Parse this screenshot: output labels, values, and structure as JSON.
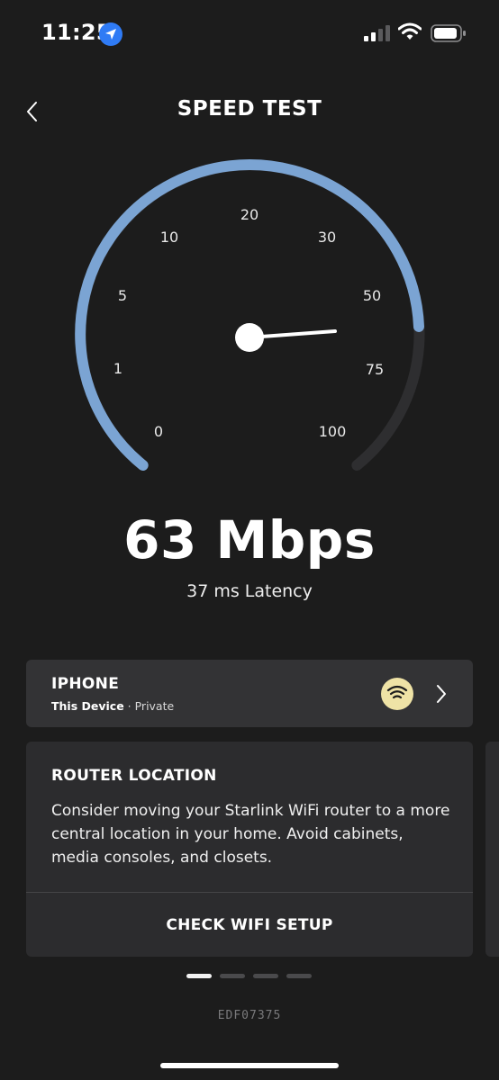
{
  "status_bar": {
    "time": "11:25",
    "location_icon": "location-arrow-icon",
    "signal_icon": "cellular-signal-icon",
    "wifi_icon": "wifi-icon",
    "battery_icon": "battery-icon"
  },
  "header": {
    "title": "SPEED TEST",
    "back_icon": "chevron-left-icon"
  },
  "gauge": {
    "scale_labels": [
      "0",
      "1",
      "5",
      "10",
      "20",
      "30",
      "50",
      "75",
      "100"
    ],
    "active_color": "#7ba4d3",
    "track_color": "#2e2e30",
    "needle_color": "#ffffff"
  },
  "result": {
    "speed": "63 Mbps",
    "latency": "37 ms Latency"
  },
  "device": {
    "name": "IPHONE",
    "label": "This Device",
    "separator": " · ",
    "network": "Private",
    "wifi_badge_color": "#efe3a6"
  },
  "tip": {
    "title": "ROUTER LOCATION",
    "body": "Consider moving your Starlink WiFi router to a more central location in your home. Avoid cabinets, media consoles, and closets.",
    "button": "CHECK WIFI SETUP"
  },
  "pager": {
    "count": 4,
    "active_index": 0
  },
  "dish_id": "EDF07375"
}
